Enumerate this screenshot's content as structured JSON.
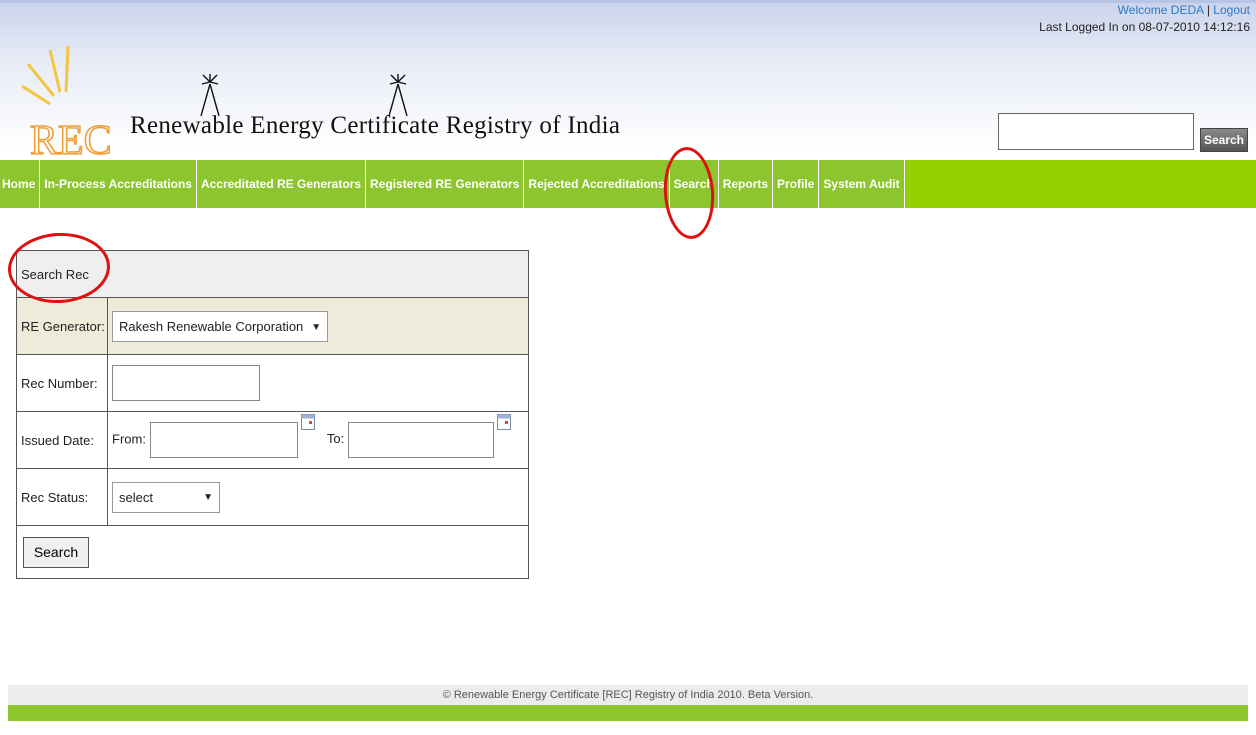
{
  "header": {
    "site_title": "Renewable Energy Certificate Registry of India",
    "logo_text": "REC",
    "welcome": "Welcome DEDA",
    "separator": "|",
    "logout": "Logout",
    "last_logged": "Last Logged In on 08-07-2010 14:12:16",
    "search_button": "Search",
    "search_value": ""
  },
  "nav": {
    "items": [
      "Home",
      "In-Process Accreditations",
      "Accreditated RE Generators",
      "Registered RE Generators",
      "Rejected Accreditations",
      "Search",
      "Reports",
      "Profile",
      "System Audit"
    ]
  },
  "form": {
    "title": "Search Rec",
    "generator_label": "RE Generator:",
    "generator_value": "Rakesh Renewable Corporation",
    "rec_number_label": "Rec Number:",
    "rec_number_value": "",
    "issued_label": "Issued Date:",
    "from_label": "From:",
    "to_label": "To:",
    "from_value": "",
    "to_value": "",
    "status_label": "Rec Status:",
    "status_value": "select",
    "search_button": "Search"
  },
  "footer": {
    "text": "© Renewable Energy Certificate [REC] Registry of India 2010. Beta Version."
  },
  "colors": {
    "nav_green": "#8cc52e",
    "link_blue": "#2f79c4",
    "annotation_red": "#dd1111"
  }
}
